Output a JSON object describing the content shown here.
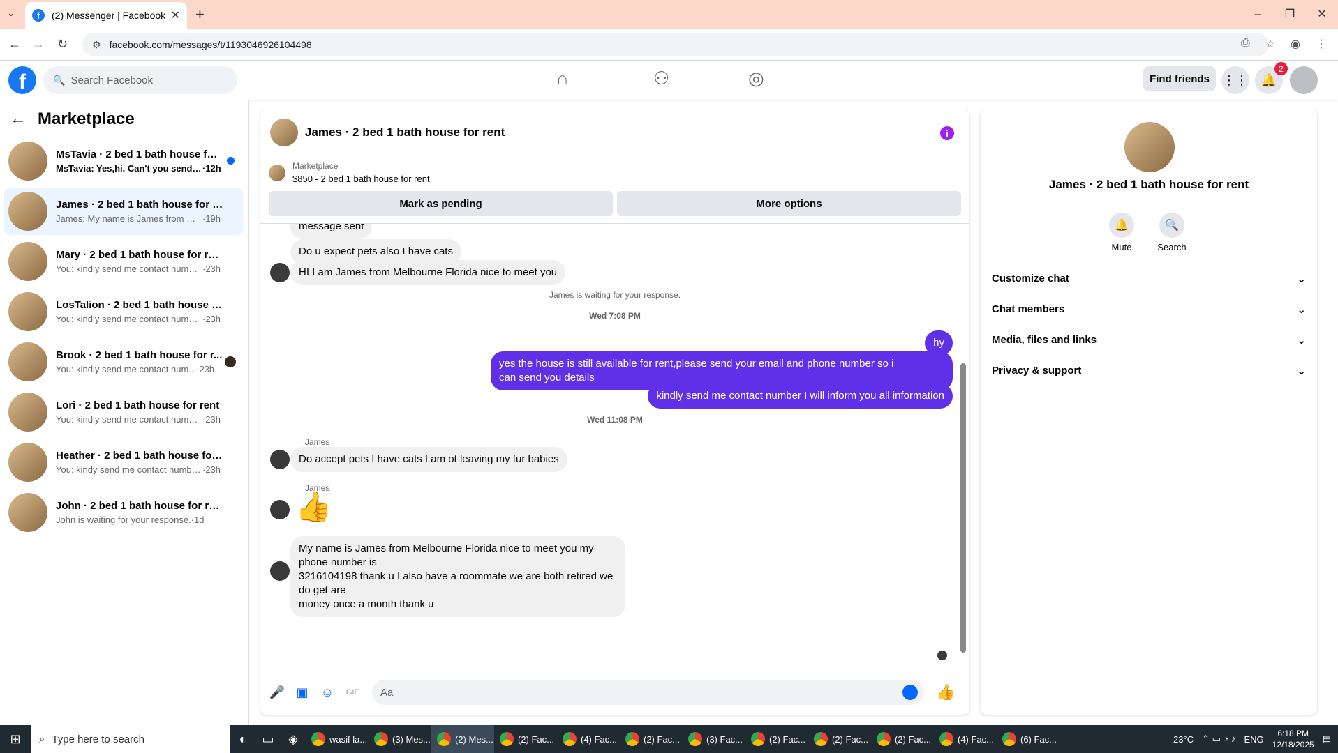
{
  "browser": {
    "tab_title": "(2) Messenger | Facebook",
    "url": "facebook.com/messages/t/1193046926104498"
  },
  "fb": {
    "search_placeholder": "Search Facebook",
    "find_friends": "Find friends",
    "notif_count": "2"
  },
  "left": {
    "title": "Marketplace",
    "conversations": [
      {
        "name": "MsTavia · 2 bed 1 bath house for ...",
        "preview": "MsTavia: Yes,hi. Can't you send th...",
        "time": "·12h"
      },
      {
        "name": "James · 2 bed 1 bath house for rent",
        "preview": "James: My name is James from Melb...",
        "time": "·19h"
      },
      {
        "name": "Mary · 2 bed 1 bath house for rent",
        "preview": "You: kindly send me contact number...",
        "time": "·23h"
      },
      {
        "name": "LosTalion · 2 bed 1 bath house for ...",
        "preview": "You: kindly send me contact number...",
        "time": "·23h"
      },
      {
        "name": "Brook · 2 bed 1 bath house for r...",
        "preview": "You: kindly send me contact num...",
        "time": "·23h"
      },
      {
        "name": "Lori · 2 bed 1 bath house for rent",
        "preview": "You: kindly send me contact number...",
        "time": "·23h"
      },
      {
        "name": "Heather · 2 bed 1 bath house for r...",
        "preview": "You: kindy send me contact number ...",
        "time": "·23h"
      },
      {
        "name": "John · 2 bed 1 bath house for rent",
        "preview": "John is waiting for your response.",
        "time": "·1d"
      }
    ]
  },
  "chat": {
    "title": "James · 2 bed 1 bath house for rent",
    "marketplace_label": "Marketplace",
    "listing": "$850 - 2 bed 1 bath house for rent",
    "mark_pending": "Mark as pending",
    "more_options": "More options",
    "m_prev": "message sent",
    "m1": "Do u expect pets also I have cats",
    "m2": "HI I am James from Melbourne Florida nice to meet you",
    "waiting": "James is waiting for your response.",
    "ts1": "Wed 7:08 PM",
    "o1": "hy",
    "o2a": "yes the house is still available for rent,please send your email and phone number so i",
    "o2b": "can send you details",
    "o3": "kindly send me contact number I will inform you all information",
    "ts2": "Wed 11:08 PM",
    "sender": "James",
    "m3": "Do accept pets I have cats I am ot leaving my fur babies",
    "m4a": "My name is James from Melbourne Florida nice to meet you my phone number is",
    "m4b": "3216104198 thank u I also have a roommate we are both retired we do get are",
    "m4c": "money once a month thank u",
    "composer_placeholder": "Aa"
  },
  "right": {
    "name": "James · 2 bed 1 bath house for rent",
    "mute": "Mute",
    "search": "Search",
    "sections": [
      "Customize chat",
      "Chat members",
      "Media, files and links",
      "Privacy & support"
    ]
  },
  "taskbar": {
    "search": "Type here to search",
    "items": [
      "wasif la...",
      "(3) Mes...",
      "(2) Mes...",
      "(2) Fac...",
      "(4) Fac...",
      "(2) Fac...",
      "(3) Fac...",
      "(2) Fac...",
      "(2) Fac...",
      "(2) Fac...",
      "(4) Fac...",
      "(6) Fac..."
    ],
    "temp": "23°C",
    "lang": "ENG",
    "time": "6:18 PM",
    "date": "12/18/2025"
  }
}
